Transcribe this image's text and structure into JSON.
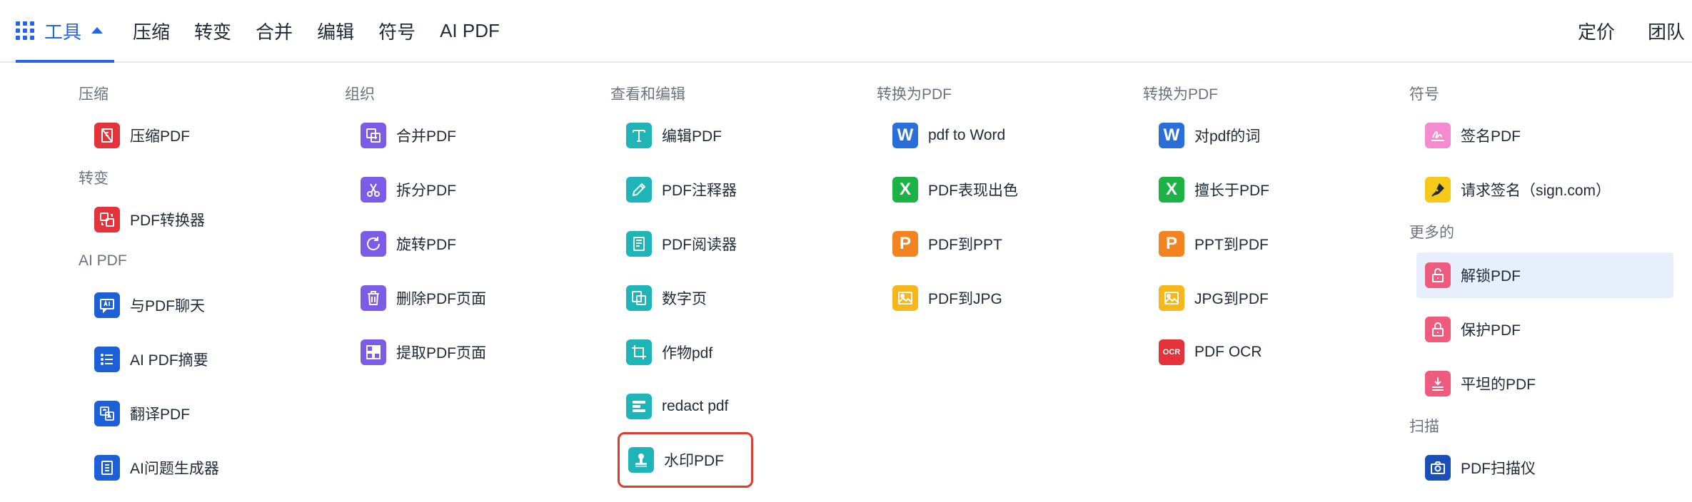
{
  "nav": {
    "tools": "工具",
    "items": [
      "压缩",
      "转变",
      "合并",
      "编辑",
      "符号",
      "AI PDF"
    ],
    "right": [
      "定价",
      "团队"
    ]
  },
  "columns": [
    {
      "sections": [
        {
          "title": "压缩",
          "items": [
            "压缩PDF"
          ]
        },
        {
          "title": "转变",
          "items": [
            "PDF转换器"
          ]
        },
        {
          "title": "AI PDF",
          "items": [
            "与PDF聊天",
            "AI PDF摘要",
            "翻译PDF",
            "AI问题生成器"
          ]
        }
      ]
    },
    {
      "sections": [
        {
          "title": "组织",
          "items": [
            "合并PDF",
            "拆分PDF",
            "旋转PDF",
            "删除PDF页面",
            "提取PDF页面"
          ]
        }
      ]
    },
    {
      "sections": [
        {
          "title": "查看和编辑",
          "items": [
            "编辑PDF",
            "PDF注释器",
            "PDF阅读器",
            "数字页",
            "作物pdf",
            "redact pdf",
            "水印PDF"
          ]
        }
      ]
    },
    {
      "sections": [
        {
          "title": "转换为PDF",
          "items": [
            "pdf to Word",
            "PDF表现出色",
            "PDF到PPT",
            "PDF到JPG"
          ]
        }
      ]
    },
    {
      "sections": [
        {
          "title": "转换为PDF",
          "items": [
            "对pdf的词",
            "擅长于PDF",
            "PPT到PDF",
            "JPG到PDF",
            "PDF OCR"
          ]
        }
      ]
    },
    {
      "sections": [
        {
          "title": "符号",
          "items": [
            "签名PDF",
            "请求签名（sign.com）"
          ]
        },
        {
          "title": "更多的",
          "items": [
            "解锁PDF",
            "保护PDF",
            "平坦的PDF"
          ]
        },
        {
          "title": "扫描",
          "items": [
            "PDF扫描仪"
          ]
        }
      ]
    }
  ],
  "icon_glyphs": {
    "word": "W",
    "excel": "X",
    "ppt": "P",
    "ocr": "OCR"
  },
  "colors": {
    "accent": "#2563eb",
    "red": "#e5333b",
    "blue": "#1d5fd6",
    "purple": "#7c5ce6",
    "teal": "#1fb5b8",
    "excel": "#1db245",
    "ppt": "#f3831f",
    "jpg": "#f7b71c",
    "pink": "#ef5b7e",
    "highlight": "#e7effc",
    "selection_box": "#e23b2b"
  }
}
